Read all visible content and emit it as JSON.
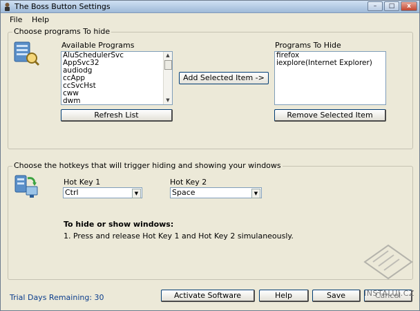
{
  "window": {
    "title": "The Boss Button Settings",
    "controls": {
      "minimize": "–",
      "maximize": "□",
      "close": "x"
    }
  },
  "menu": {
    "file": "File",
    "help": "Help"
  },
  "programs_group": {
    "legend": "Choose programs To hide",
    "available_label": "Available Programs",
    "available": [
      "AluSchedulerSvc",
      "AppSvc32",
      "audiodg",
      "ccApp",
      "ccSvcHst",
      "cww",
      "dwm"
    ],
    "hide_label": "Programs To Hide",
    "to_hide": [
      "firefox",
      "iexplore(Internet Explorer)"
    ],
    "add_button": "Add Selected Item ->",
    "refresh_button": "Refresh List",
    "remove_button": "Remove Selected Item"
  },
  "hotkeys_group": {
    "legend": "Choose the hotkeys that will trigger hiding and showing your windows",
    "hotkey1_label": "Hot Key 1",
    "hotkey1_value": "Ctrl",
    "hotkey2_label": "Hot Key 2",
    "hotkey2_value": "Space",
    "instructions_title": "To hide or show windows:",
    "instructions_step": "1.  Press and release Hot Key 1 and Hot Key 2 simulaneously."
  },
  "footer": {
    "trial": "Trial Days Remaining: 30",
    "activate": "Activate Software",
    "help": "Help",
    "save": "Save",
    "cancel": "Cancel"
  },
  "watermark": "INSTALUJ.CZ",
  "colors": {
    "accent": "#0b3d8c",
    "window_bg": "#ece9d8",
    "border_blue": "#7f9db9"
  }
}
